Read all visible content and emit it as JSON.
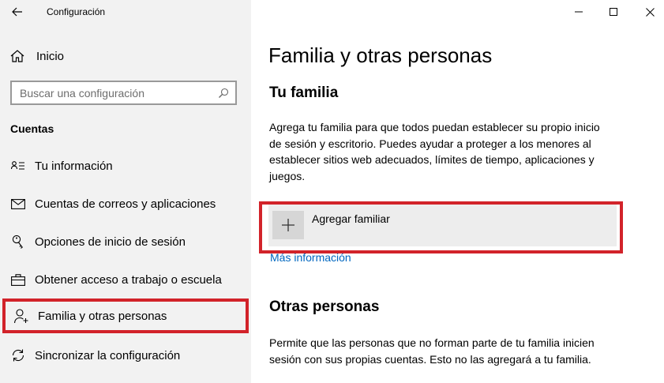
{
  "window": {
    "title": "Configuración"
  },
  "sidebar": {
    "home_label": "Inicio",
    "search_placeholder": "Buscar una configuración",
    "section_title": "Cuentas",
    "items": [
      {
        "label": "Tu información",
        "icon": "person-card-icon"
      },
      {
        "label": "Cuentas de correos y aplicaciones",
        "icon": "mail-icon"
      },
      {
        "label": "Opciones de inicio de sesión",
        "icon": "key-icon"
      },
      {
        "label": "Obtener acceso a trabajo o escuela",
        "icon": "briefcase-icon"
      },
      {
        "label": "Familia y otras personas",
        "icon": "person-add-icon",
        "selected": true
      },
      {
        "label": "Sincronizar la configuración",
        "icon": "sync-icon"
      }
    ]
  },
  "main": {
    "title": "Familia y otras personas",
    "family": {
      "heading": "Tu familia",
      "description": "Agrega tu familia para que todos puedan establecer su propio inicio de sesión y escritorio. Puedes ayudar a proteger a los menores al establecer sitios web adecuados, límites de tiempo, aplicaciones y juegos.",
      "add_label": "Agregar familiar",
      "more_info": "Más información"
    },
    "others": {
      "heading": "Otras personas",
      "description": "Permite que las personas que no forman parte de tu familia inicien sesión con sus propias cuentas. Esto no las agregará a tu familia."
    }
  },
  "colors": {
    "highlight": "#d2232a",
    "link": "#0067c0",
    "sidebar_bg": "#f2f2f2"
  }
}
